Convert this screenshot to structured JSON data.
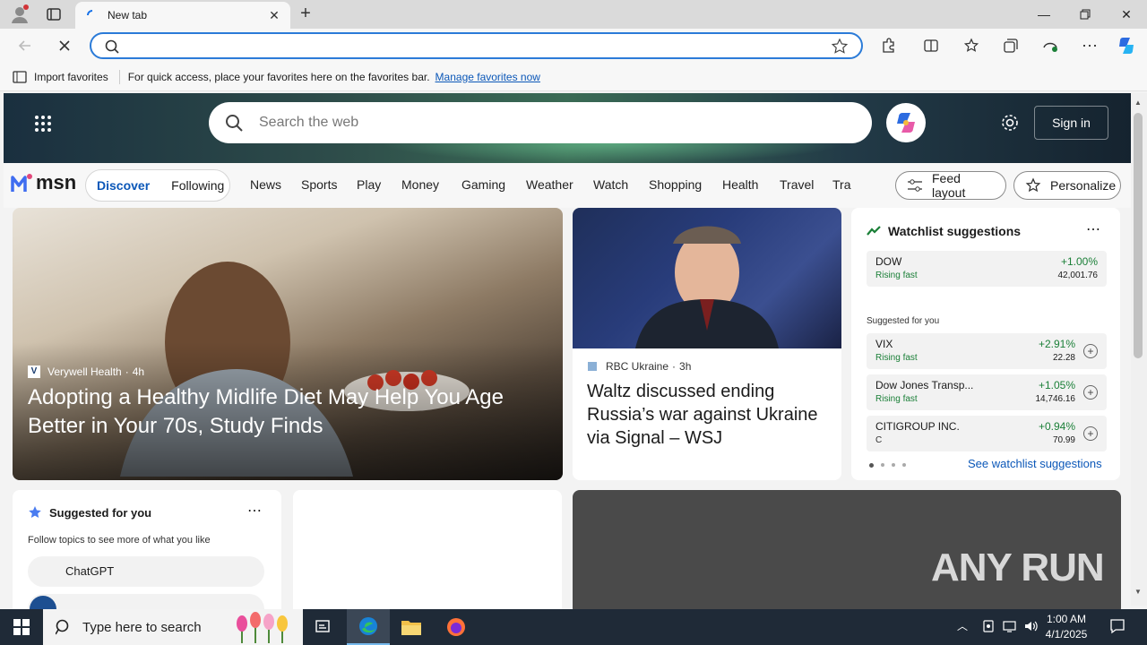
{
  "browser": {
    "tab_title": "New tab",
    "favorites_bar": {
      "import_label": "Import favorites",
      "message": "For quick access, place your favorites here on the favorites bar.",
      "manage_link": "Manage favorites now"
    }
  },
  "msn": {
    "search_placeholder": "Search the web",
    "signin_label": "Sign in",
    "logo": "msn",
    "pill_tabs": [
      "Discover",
      "Following"
    ],
    "nav_links": [
      "News",
      "Sports",
      "Play",
      "Money",
      "Gaming",
      "Weather",
      "Watch",
      "Shopping",
      "Health",
      "Travel",
      "Tra"
    ],
    "feed_layout_label": "Feed layout",
    "personalize_label": "Personalize",
    "main_story": {
      "source": "Verywell Health",
      "age": "4h",
      "title": "Adopting a Healthy Midlife Diet May Help You Age Better in Your 70s, Study Finds"
    },
    "news_story": {
      "source": "RBC Ukraine",
      "age": "3h",
      "title": "Waltz discussed ending Russia’s war against Ukraine via Signal – WSJ"
    },
    "watchlist": {
      "title": "Watchlist suggestions",
      "top": {
        "name": "DOW",
        "status": "Rising fast",
        "change": "+1.00%",
        "value": "42,001.76"
      },
      "suggested_label": "Suggested for you",
      "items": [
        {
          "name": "VIX",
          "status": "Rising fast",
          "change": "+2.91%",
          "value": "22.28"
        },
        {
          "name": "Dow Jones Transp...",
          "status": "Rising fast",
          "change": "+1.05%",
          "value": "14,746.16"
        },
        {
          "name": "CITIGROUP INC.",
          "status": "C",
          "change": "+0.94%",
          "value": "70.99"
        }
      ],
      "see_link": "See watchlist suggestions"
    },
    "suggested": {
      "title": "Suggested for you",
      "subtitle": "Follow topics to see more of what you like",
      "topic": "ChatGPT"
    },
    "watermark": "ANY RUN"
  },
  "taskbar": {
    "search_placeholder": "Type here to search",
    "time": "1:00 AM",
    "date": "4/1/2025"
  },
  "colors": {
    "accent": "#2b7bd8",
    "rising": "#1a7f37",
    "link": "#0b57b8"
  }
}
